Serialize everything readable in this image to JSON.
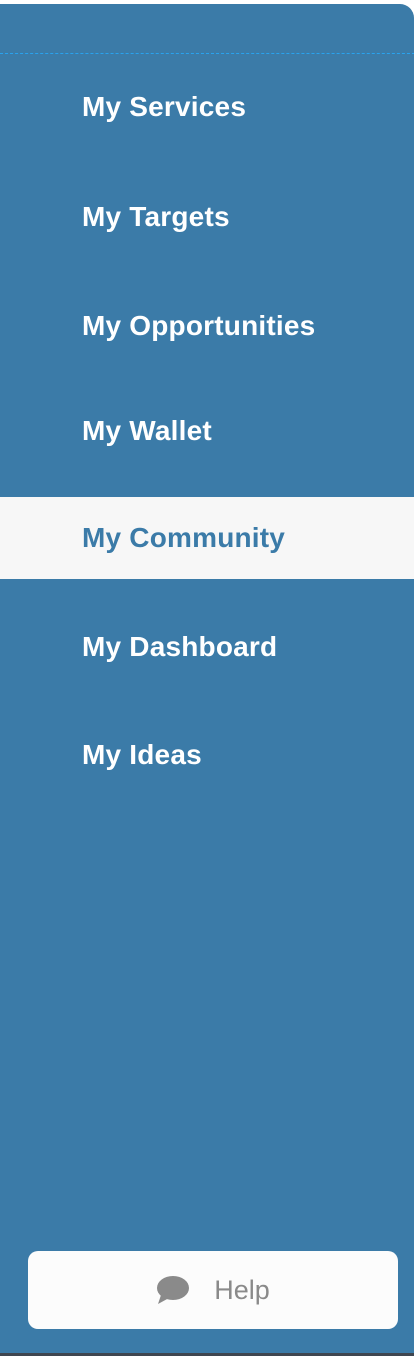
{
  "sidebar": {
    "items": [
      {
        "label": "My Services",
        "active": false
      },
      {
        "label": "My Targets",
        "active": false
      },
      {
        "label": "My Opportunities",
        "active": false
      },
      {
        "label": "My Wallet",
        "active": false
      },
      {
        "label": "My Community",
        "active": true
      },
      {
        "label": "My Dashboard",
        "active": false
      },
      {
        "label": "My Ideas",
        "active": false
      }
    ],
    "help": {
      "label": "Help",
      "icon": "chat-bubble-icon"
    }
  },
  "colors": {
    "sidebar_bg": "#3b7ba8",
    "active_bg": "#f7f7f7",
    "active_text": "#3b7ba8",
    "text": "#ffffff",
    "help_text": "#8a8a8a"
  }
}
